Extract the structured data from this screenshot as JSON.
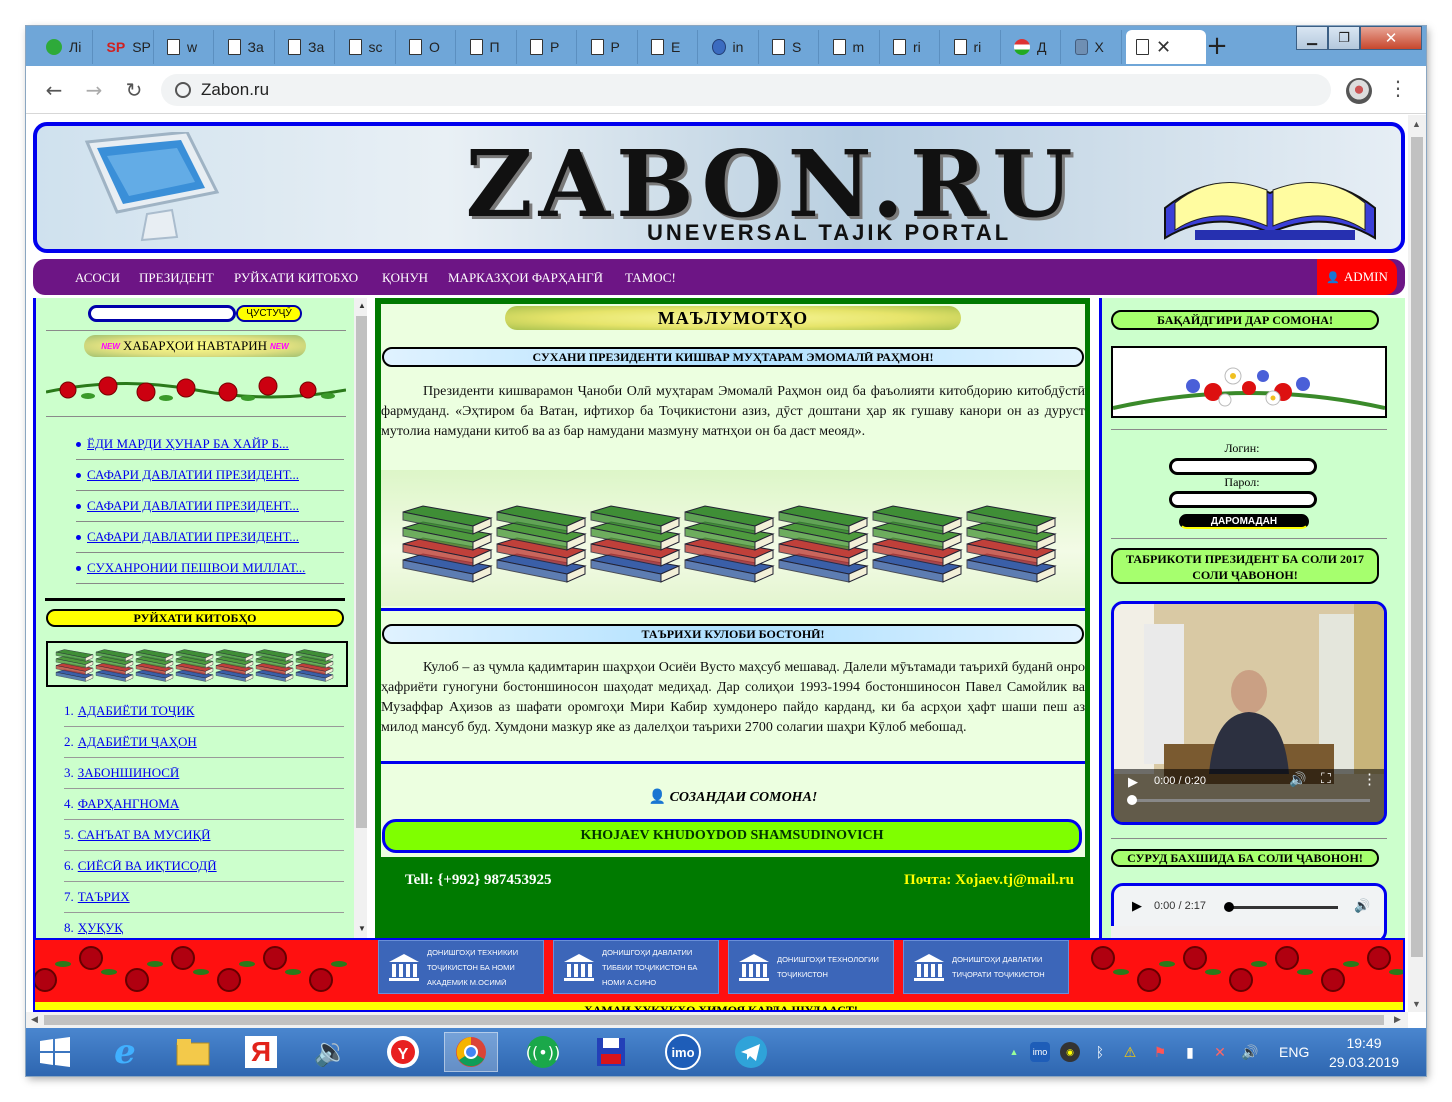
{
  "browser": {
    "tabs": [
      {
        "label": "Лі",
        "icon": "green-circle-icon"
      },
      {
        "label": "SP За",
        "icon": "sp-icon"
      },
      {
        "label": "w",
        "icon": "page-icon"
      },
      {
        "label": "За",
        "icon": "page-icon"
      },
      {
        "label": "За",
        "icon": "page-icon"
      },
      {
        "label": "sc",
        "icon": "page-icon"
      },
      {
        "label": "О",
        "icon": "page-icon"
      },
      {
        "label": "П",
        "icon": "page-icon"
      },
      {
        "label": "Р",
        "icon": "page-icon"
      },
      {
        "label": "Р",
        "icon": "page-icon"
      },
      {
        "label": "Е",
        "icon": "page-icon"
      },
      {
        "label": "in",
        "icon": "blue-icon"
      },
      {
        "label": "S",
        "icon": "page-icon"
      },
      {
        "label": "m",
        "icon": "page-icon"
      },
      {
        "label": "ri",
        "icon": "page-icon"
      },
      {
        "label": "ri",
        "icon": "page-icon"
      },
      {
        "label": "Д",
        "icon": "flag-icon"
      },
      {
        "label": "X",
        "icon": "shield-icon"
      }
    ],
    "url": "Zabon.ru"
  },
  "banner": {
    "title": "ZABON.RU",
    "subtitle": "UNEVERSAL TAJIK PORTAL"
  },
  "nav": {
    "items": [
      "АСОСИ",
      "ПРЕЗИДЕНТ",
      "РУЙХАТИ КИТОБХО",
      "ҚОНУН",
      "МАРКАЗҲОИ ФАРҲАНГӢ",
      "ТАМОС!"
    ],
    "admin": "ADMIN"
  },
  "left": {
    "search_button": "ҶУСТУҶӮ",
    "news_title": "ХАБАРҲОИ НАВТАРИН",
    "news_badge": "NEW",
    "news": [
      "ЁДИ МАРДИ ҲУНАР БА ХАЙР Б...",
      "САФАРИ ДАВЛАТИИ ПРЕЗИДЕНТ...",
      "САФАРИ ДАВЛАТИИ ПРЕЗИДЕНТ...",
      "САФАРИ ДАВЛАТИИ ПРЕЗИДЕНТ...",
      "СУХАНРОНИИ ПЕШВОИ МИЛЛАТ..."
    ],
    "books_title": "РУЙХАТИ КИТОБҲО",
    "categories": [
      "АДАБИЁТИ ТОҶИК",
      "АДАБИЁТИ ҶАҲОН",
      "ЗАБОНШИНОСӢ",
      "ФАРҲАНГНОМА",
      "САНЪАТ ВА МУСИҚӢ",
      "СИЁСӢ ВА ИҚТИСОДӢ",
      "ТАЪРИХ",
      "ҲУҚУҚ"
    ]
  },
  "center": {
    "header": "МАЪЛУМОТҲО",
    "section1_title": "СУХАНИ ПРЕЗИДЕНТИ КИШВАР МУҲТАРАМ ЭМОМАЛӢ РАҲМОН!",
    "section1_text": "Президенти кишварамон Ҷаноби Олӣ муҳтарам Эмомалӣ Раҳмон оид ба фаъолияти китобдорию китобдӯстӣ фармуданд. «Эҳтиром ба Ватан, ифтихор ба Тоҷикистони азиз, дӯст доштани ҳар як гушаву канори он аз дуруст мутолиа намудани китоб ва аз бар намудани мазмуну матнҳои он ба даст меояд».",
    "section2_title": "ТАЪРИХИ КУЛОБИ БОСТОНӢ!",
    "section2_text": "Кулоб – аз ҷумла қадимтарин шаҳрҳои Осиёи Вусто маҳсуб мешавад. Далели мӯътамади таърихӣ буданӣ онро ҳафриёти гуногуни бостоншиносон шаҳодат медиҳад. Дар солиҳои 1993-1994 бостоншиносон Павел Самойлик ва Музаффар Аҳизов аз шафати оромгоҳи Мири Кабир хумдонеро пайдо карданд, ки ба асрҳои ҳафт шаши пеш аз милод мансуб буд. Хумдони мазкур яке аз далелҳои таърихи 2700 солагии шаҳри Кӯлоб мебошад.",
    "creator_label": "СОЗАНДАИ СОМОНА!",
    "creator_name": "KHOJAEV KHUDOYDOD SHAMSUDINOVICH",
    "tel": "Tell: {+992} 987453925",
    "mail": "Почта: Xojaev.tj@mail.ru"
  },
  "right": {
    "register_title": "БАҚАЙДГИРИ ДАР СОМОНА!",
    "login_label": "Логин:",
    "password_label": "Парол:",
    "login_button": "ДАРОМАДАН",
    "greeting_title": "ТАБРИКОТИ ПРЕЗИДЕНТ БА СОЛИ 2017 СОЛИ ҶАВОНОН!",
    "video_time": "0:00 / 0:20",
    "anthem_title": "СУРУД БАХШИДА БА СОЛИ ҶАВОНОН!",
    "audio_time": "0:00 / 2:17"
  },
  "bottom": {
    "universities": [
      {
        "line1": "ДОНИШГОҲИ ТЕХНИКИИ",
        "line2": "ТОҶИКИСТОН БА НОМИ",
        "line3": "АКАДЕМИК М.ОСИМӢ"
      },
      {
        "line1": "ДОНИШГОҲИ ДАВЛАТИИ",
        "line2": "ТИББИИ ТОҶИКИСТОН БА",
        "line3": "НОМИ А.СИНО"
      },
      {
        "line1": "ДОНИШГОҲИ ТЕХНОЛОГИИ",
        "line2": "ТОҶИКИСТОН",
        "line3": ""
      },
      {
        "line1": "ДОНИШГОҲИ ДАВЛАТИИ",
        "line2": "ТИҶОРАТИ ТОҶИКИСТОН",
        "line3": ""
      }
    ],
    "ticker": "ҲАМАИ ҲУҚУҚҲО ҲИМОЯ КАРДА ШУДААСТ!"
  },
  "taskbar": {
    "lang": "ENG",
    "time": "19:49",
    "date": "29.03.2019"
  },
  "colors": {
    "nav_purple": "#6d1585",
    "border_blue": "#0000ee",
    "center_green": "#007a00",
    "column_green": "#ccffcc",
    "admin_red": "#ff0000"
  }
}
